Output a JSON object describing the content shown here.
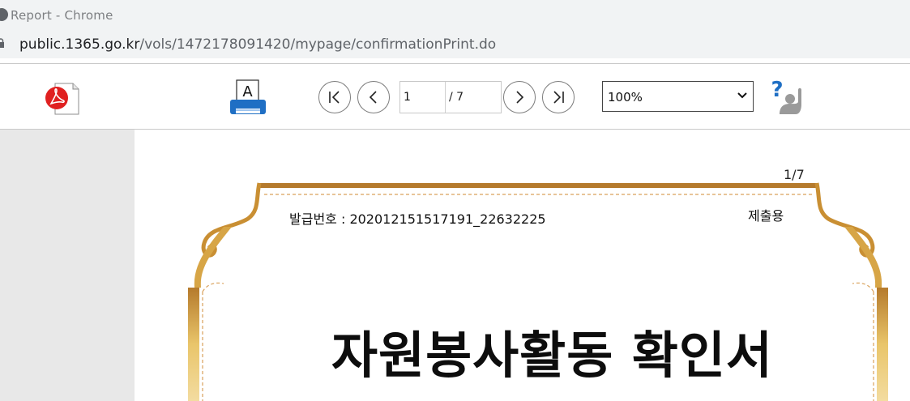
{
  "browser": {
    "window_title": "Report - Chrome",
    "url_host": "public.1365.go.kr",
    "url_path": "/vols/1472178091420/mypage/confirmationPrint.do"
  },
  "toolbar": {
    "current_page": "1",
    "total_pages": "/ 7",
    "zoom": "100%",
    "pdf_icon": "pdf-icon",
    "print_icon": "printer-icon",
    "help_icon": "help-icon",
    "help_mark": "?",
    "print_sheet_letter": "A"
  },
  "document": {
    "page_indicator": "1/7",
    "issue_number": "발급번호 : 202012151517191_22632225",
    "submission_label": "제출용",
    "title": "자원봉사활동 확인서"
  },
  "colors": {
    "gold_dark": "#b57a2c",
    "gold_light": "#e9c56a",
    "pdf_red": "#e02020",
    "print_blue": "#1f6fc4",
    "help_blue": "#1f6fc4"
  }
}
